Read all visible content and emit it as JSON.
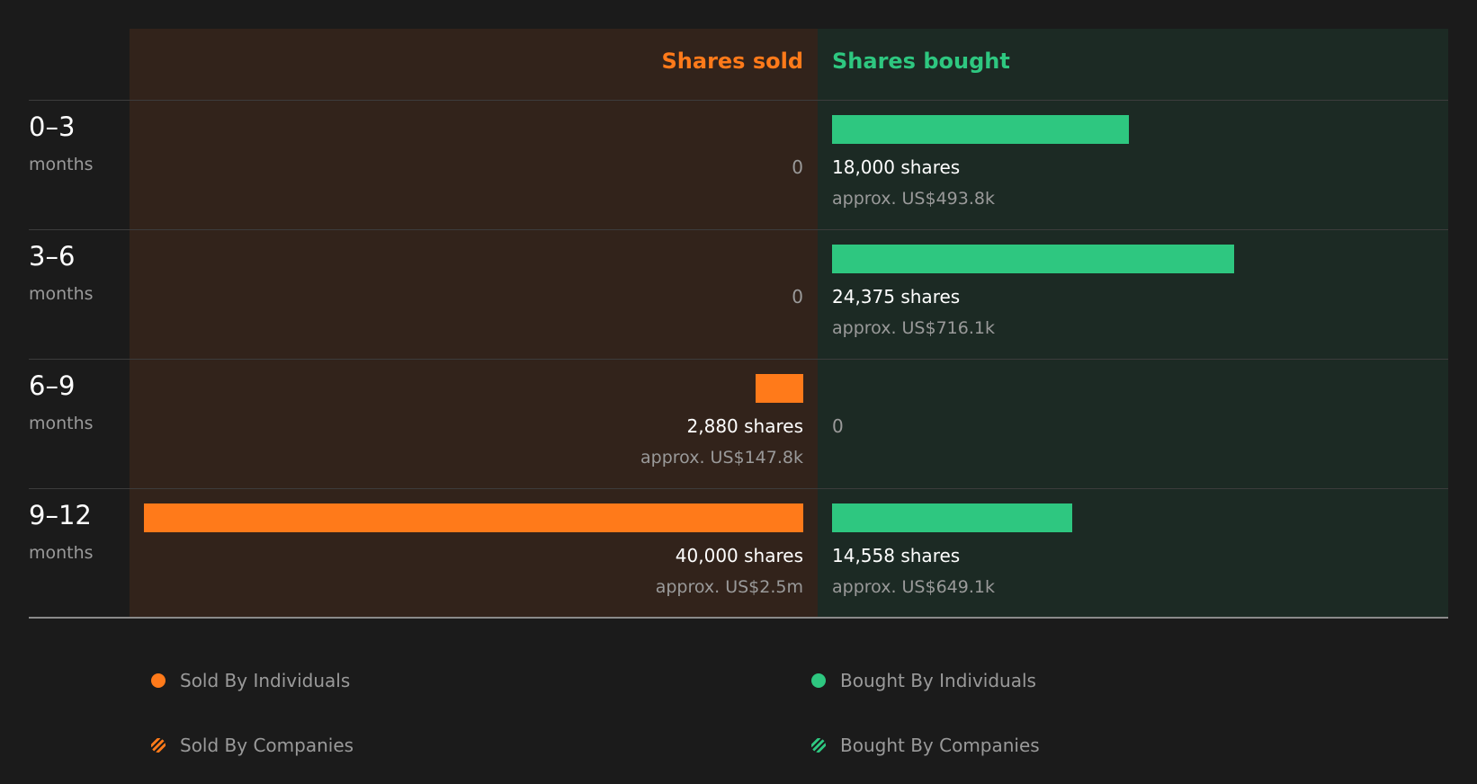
{
  "colors": {
    "sold": "#ff7a1a",
    "bought": "#2ec780",
    "stripe_bg": "#1b1b1b"
  },
  "chart_data": {
    "type": "bar",
    "orientation": "horizontal diverging",
    "headers": {
      "sold": "Shares sold",
      "bought": "Shares bought"
    },
    "max_shares": 40000,
    "rows": [
      {
        "range": "0–3",
        "unit": "months",
        "sold_shares": 0,
        "sold_amount": "0",
        "sold_value": "",
        "bought_shares": 18000,
        "bought_amount": "18,000 shares",
        "bought_value": "approx. US$493.8k"
      },
      {
        "range": "3–6",
        "unit": "months",
        "sold_shares": 0,
        "sold_amount": "0",
        "sold_value": "",
        "bought_shares": 24375,
        "bought_amount": "24,375 shares",
        "bought_value": "approx. US$716.1k"
      },
      {
        "range": "6–9",
        "unit": "months",
        "sold_shares": 2880,
        "sold_amount": "2,880 shares",
        "sold_value": "approx. US$147.8k",
        "bought_shares": 0,
        "bought_amount": "0",
        "bought_value": ""
      },
      {
        "range": "9–12",
        "unit": "months",
        "sold_shares": 40000,
        "sold_amount": "40,000 shares",
        "sold_value": "approx. US$2.5m",
        "bought_shares": 14558,
        "bought_amount": "14,558 shares",
        "bought_value": "approx. US$649.1k"
      }
    ],
    "legend": [
      {
        "label": "Sold By Individuals",
        "color": "#ff7a1a",
        "pattern": "solid"
      },
      {
        "label": "Bought By Individuals",
        "color": "#2ec780",
        "pattern": "solid"
      },
      {
        "label": "Sold By Companies",
        "color": "#ff7a1a",
        "pattern": "striped"
      },
      {
        "label": "Bought By Companies",
        "color": "#2ec780",
        "pattern": "striped"
      }
    ]
  }
}
